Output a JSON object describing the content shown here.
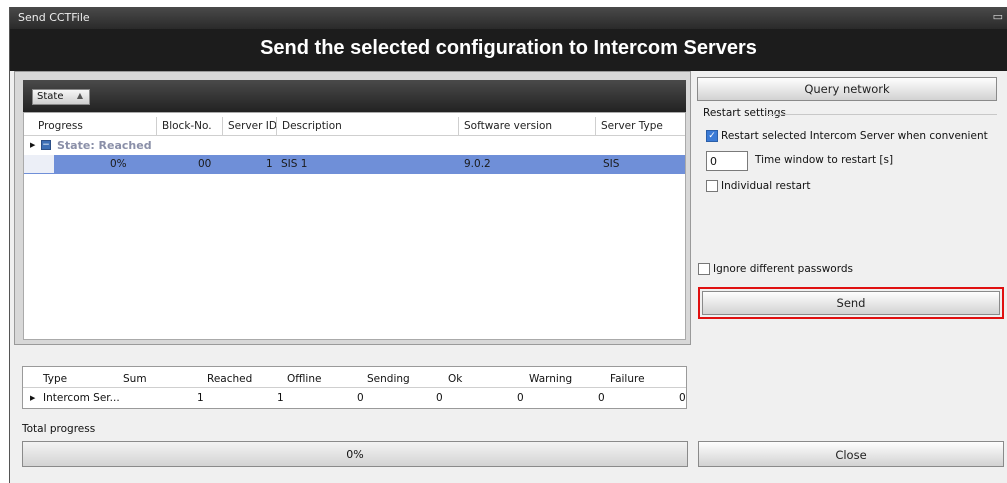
{
  "window": {
    "title": "Send  CCTFile",
    "control": "▭"
  },
  "header": {
    "title": "Send the selected configuration to Intercom Servers"
  },
  "grouping": {
    "chip_label": "State",
    "chip_arrow": "▲"
  },
  "grid": {
    "columns": [
      "Progress",
      "Block-No.",
      "Server ID",
      "Description",
      "Software version",
      "Server Type"
    ],
    "group": {
      "label": "State: Reached"
    },
    "rows": [
      {
        "progress": "0%",
        "block_no": "00",
        "server_id": "1",
        "description": "SIS 1",
        "software_version": "9.0.2",
        "server_type": "SIS"
      }
    ]
  },
  "right": {
    "query_label": "Query network",
    "restart_title": "Restart settings",
    "restart_convenient_label": "Restart selected Intercom Server when convenient",
    "restart_convenient_checked": true,
    "time_window_value": "0",
    "time_window_label": "Time window to restart [s]",
    "individual_restart_label": "Individual restart",
    "individual_restart_checked": false,
    "ignore_passwords_label": "Ignore different passwords",
    "ignore_passwords_checked": false,
    "send_label": "Send",
    "close_label": "Close"
  },
  "stats": {
    "columns": [
      "Type",
      "Sum",
      "Reached",
      "Offline",
      "Sending",
      "Ok",
      "Warning",
      "Failure"
    ],
    "rows": [
      {
        "type": "Intercom Ser...",
        "sum": "1",
        "reached": "1",
        "offline": "0",
        "sending": "0",
        "ok": "0",
        "warning": "0",
        "failure": "0"
      }
    ]
  },
  "total_progress": {
    "label": "Total progress",
    "value": "0%"
  },
  "colors": {
    "highlight_border": "#e01010",
    "selected_row": "#6f8fd8",
    "header_bg": "#1c1c1c"
  }
}
